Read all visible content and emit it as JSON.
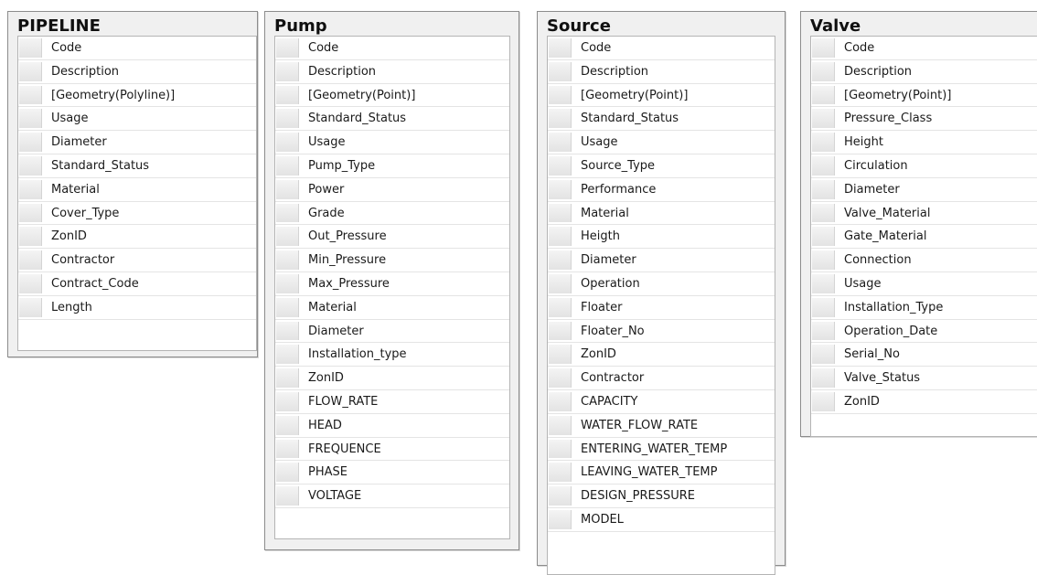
{
  "tables": [
    {
      "title": "PIPELINE",
      "fields": [
        "Code",
        "Description",
        "[Geometry(Polyline)]",
        "Usage",
        "Diameter",
        "Standard_Status",
        "Material",
        "Cover_Type",
        "ZonID",
        "Contractor",
        "Contract_Code",
        "Length"
      ]
    },
    {
      "title": "Pump",
      "fields": [
        "Code",
        "Description",
        "[Geometry(Point)]",
        "Standard_Status",
        "Usage",
        "Pump_Type",
        "Power",
        "Grade",
        "Out_Pressure",
        "Min_Pressure",
        "Max_Pressure",
        "Material",
        "Diameter",
        "Installation_type",
        "ZonID",
        "FLOW_RATE",
        "HEAD",
        "FREQUENCE",
        "PHASE",
        "VOLTAGE"
      ]
    },
    {
      "title": "Source",
      "fields": [
        "Code",
        "Description",
        "[Geometry(Point)]",
        "Standard_Status",
        "Usage",
        "Source_Type",
        "Performance",
        "Material",
        "Heigth",
        "Diameter",
        "Operation",
        "Floater",
        "Floater_No",
        "ZonID",
        "Contractor",
        "CAPACITY",
        "WATER_FLOW_RATE",
        "ENTERING_WATER_TEMP",
        "LEAVING_WATER_TEMP",
        "DESIGN_PRESSURE",
        "MODEL"
      ]
    },
    {
      "title": "Valve",
      "fields": [
        "Code",
        "Description",
        "[Geometry(Point)]",
        "Pressure_Class",
        "Height",
        "Circulation",
        "Diameter",
        "Valve_Material",
        "Gate_Material",
        "Connection",
        "Usage",
        "Installation_Type",
        "Operation_Date",
        "Serial_No",
        "Valve_Status",
        "ZonID"
      ]
    }
  ]
}
